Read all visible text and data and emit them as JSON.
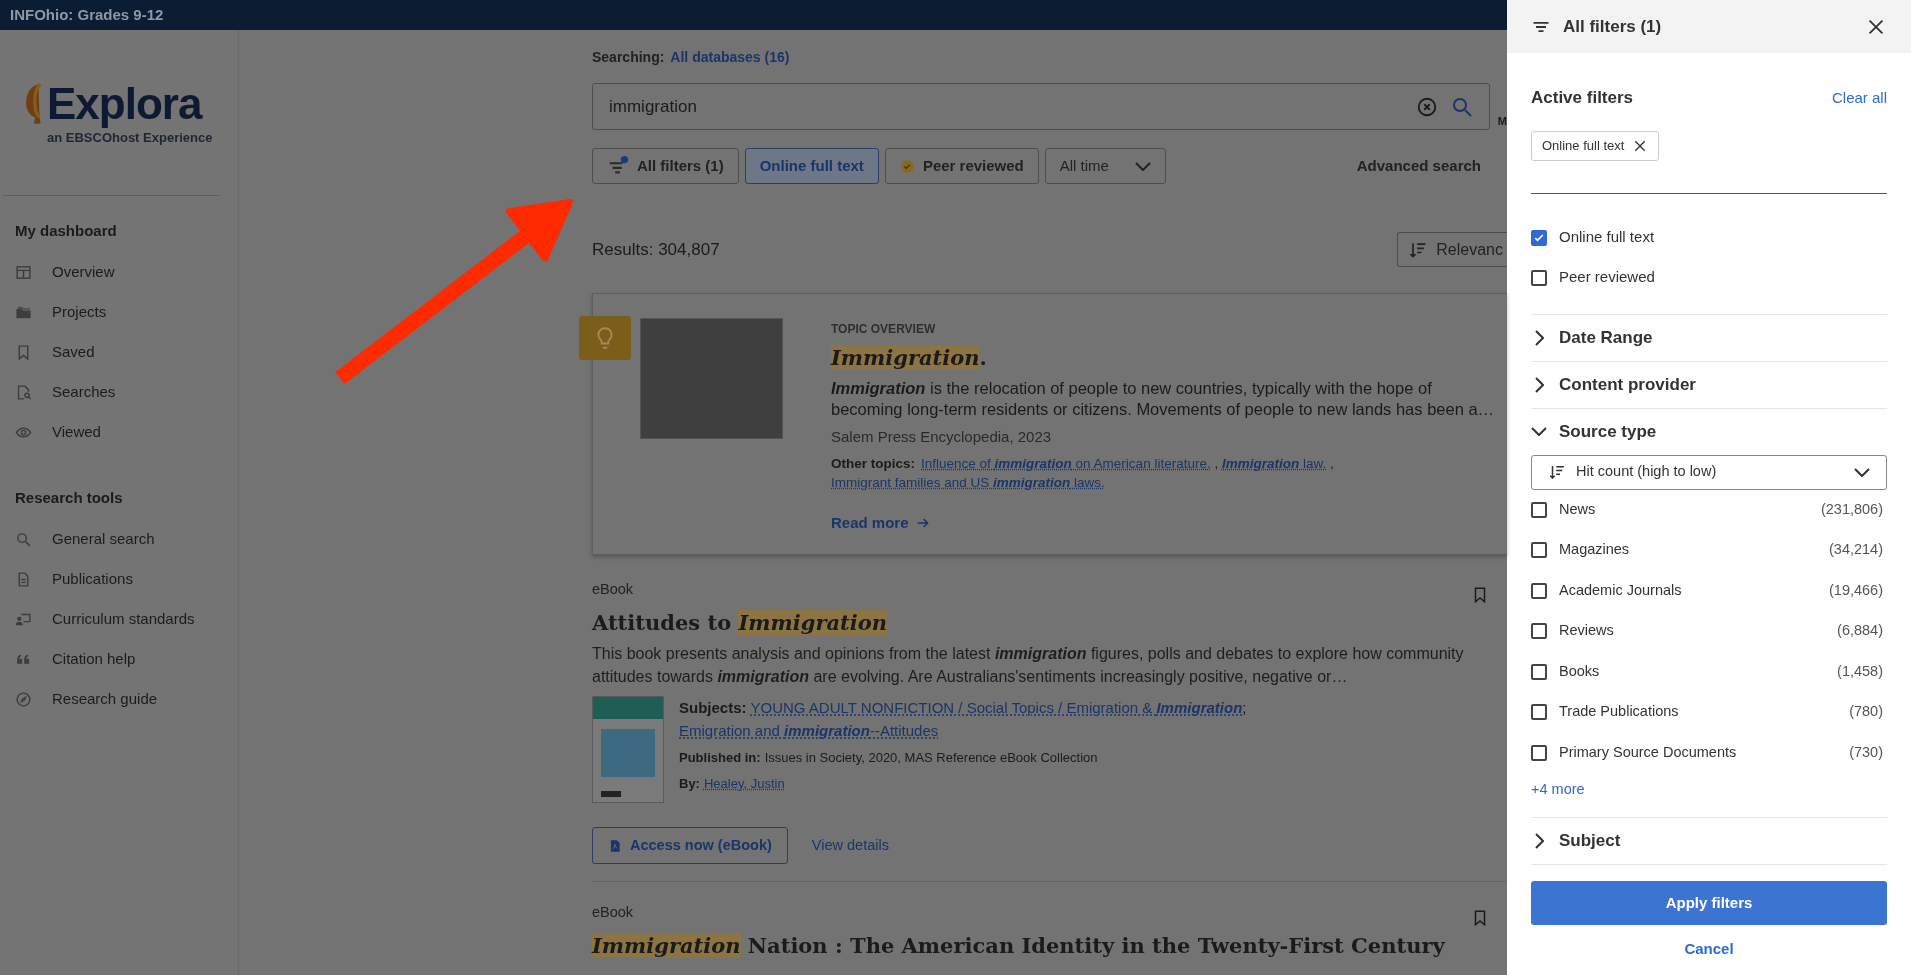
{
  "top_bar": {
    "title": "INFOhio: Grades 9-12"
  },
  "logo": {
    "name": "Explora",
    "tagline": "an EBSCOhost Experience"
  },
  "sidebar": {
    "sections": [
      {
        "heading": "My dashboard",
        "items": [
          {
            "label": "Overview"
          },
          {
            "label": "Projects"
          },
          {
            "label": "Saved"
          },
          {
            "label": "Searches"
          },
          {
            "label": "Viewed"
          }
        ]
      },
      {
        "heading": "Research tools",
        "items": [
          {
            "label": "General search"
          },
          {
            "label": "Publications"
          },
          {
            "label": "Curriculum standards"
          },
          {
            "label": "Citation help"
          },
          {
            "label": "Research guide"
          }
        ]
      }
    ]
  },
  "search": {
    "scope_label": "Searching:",
    "scope": "All databases (16)",
    "value": "immigration",
    "side_label": "M"
  },
  "filter_chips": [
    {
      "kind": "filters",
      "label": "All filters (1)"
    },
    {
      "kind": "toggle",
      "label": "Online full text",
      "selected": true
    },
    {
      "kind": "peer",
      "label": "Peer reviewed",
      "selected": false
    },
    {
      "kind": "dropdown",
      "label": "All time"
    }
  ],
  "advanced_search": "Advanced search",
  "results_count": "Results: 304,807",
  "sort": "Relevanc",
  "topic_card": {
    "eyebrow": "TOPIC OVERVIEW",
    "title": [
      {
        "text": "Immigration",
        "highlight": true
      },
      {
        "text": ".",
        "highlight": false
      }
    ],
    "summary": "**Immigration** is the relocation of people to new countries, typically with the hope of becoming long-term residents or citizens. Movements of people to new lands has been a…",
    "source": "Salem Press Encyclopedia, 2023",
    "other_topics_label": "Other topics:",
    "topics_separator": " , ",
    "other_topics": [
      "Influence of **immigration** on American literature.",
      "**Immigration** law.",
      "Immigrant families and US **immigration** laws."
    ],
    "read_more": "Read more"
  },
  "results": [
    {
      "type": "eBook",
      "title": [
        {
          "text": "Attitudes to ",
          "highlight": false
        },
        {
          "text": "Immigration",
          "highlight": true
        }
      ],
      "abstract": "This book presents analysis and opinions from the latest **immigration** figures, polls and debates to explore how community attitudes towards **immigration** are evolving. Are Australians'sentiments increasingly positive, negative or…",
      "subjects_label": "Subjects:",
      "subjects_separator": ";",
      "subjects": [
        "YOUNG ADULT NONFICTION / Social Topics / Emigration & **Immigration**",
        "Emigration and **immigration**--Attitudes"
      ],
      "published_label": "Published in:",
      "published": "Issues in Society, 2020, MAS Reference eBook Collection",
      "by_label": "By:",
      "author": "Healey, Justin",
      "access": "Access now (eBook)",
      "details": "View details"
    },
    {
      "type": "eBook",
      "title": [
        {
          "text": "Immigration",
          "highlight": true
        },
        {
          "text": " Nation : The American Identity in the Twenty-First Century",
          "highlight": false
        }
      ]
    }
  ],
  "filter_panel": {
    "title": "All filters (1)",
    "active_heading": "Active filters",
    "clear_all": "Clear all",
    "active_tags": [
      "Online full text"
    ],
    "quick_filters": [
      {
        "label": "Online full text",
        "checked": true
      },
      {
        "label": "Peer reviewed",
        "checked": false
      }
    ],
    "sections": [
      {
        "label": "Date Range",
        "expanded": false
      },
      {
        "label": "Content provider",
        "expanded": false
      },
      {
        "label": "Source type",
        "expanded": true,
        "sort": "Hit count (high to low)",
        "more": "+4 more",
        "options": [
          {
            "label": "News",
            "count": "(231,806)",
            "checked": false
          },
          {
            "label": "Magazines",
            "count": "(34,214)",
            "checked": false
          },
          {
            "label": "Academic Journals",
            "count": "(19,466)",
            "checked": false
          },
          {
            "label": "Reviews",
            "count": "(6,884)",
            "checked": false
          },
          {
            "label": "Books",
            "count": "(1,458)",
            "checked": false
          },
          {
            "label": "Trade Publications",
            "count": "(780)",
            "checked": false
          },
          {
            "label": "Primary Source Documents",
            "count": "(730)",
            "checked": false
          }
        ]
      },
      {
        "label": "Subject",
        "expanded": false
      }
    ],
    "apply": "Apply filters",
    "cancel": "Cancel"
  }
}
